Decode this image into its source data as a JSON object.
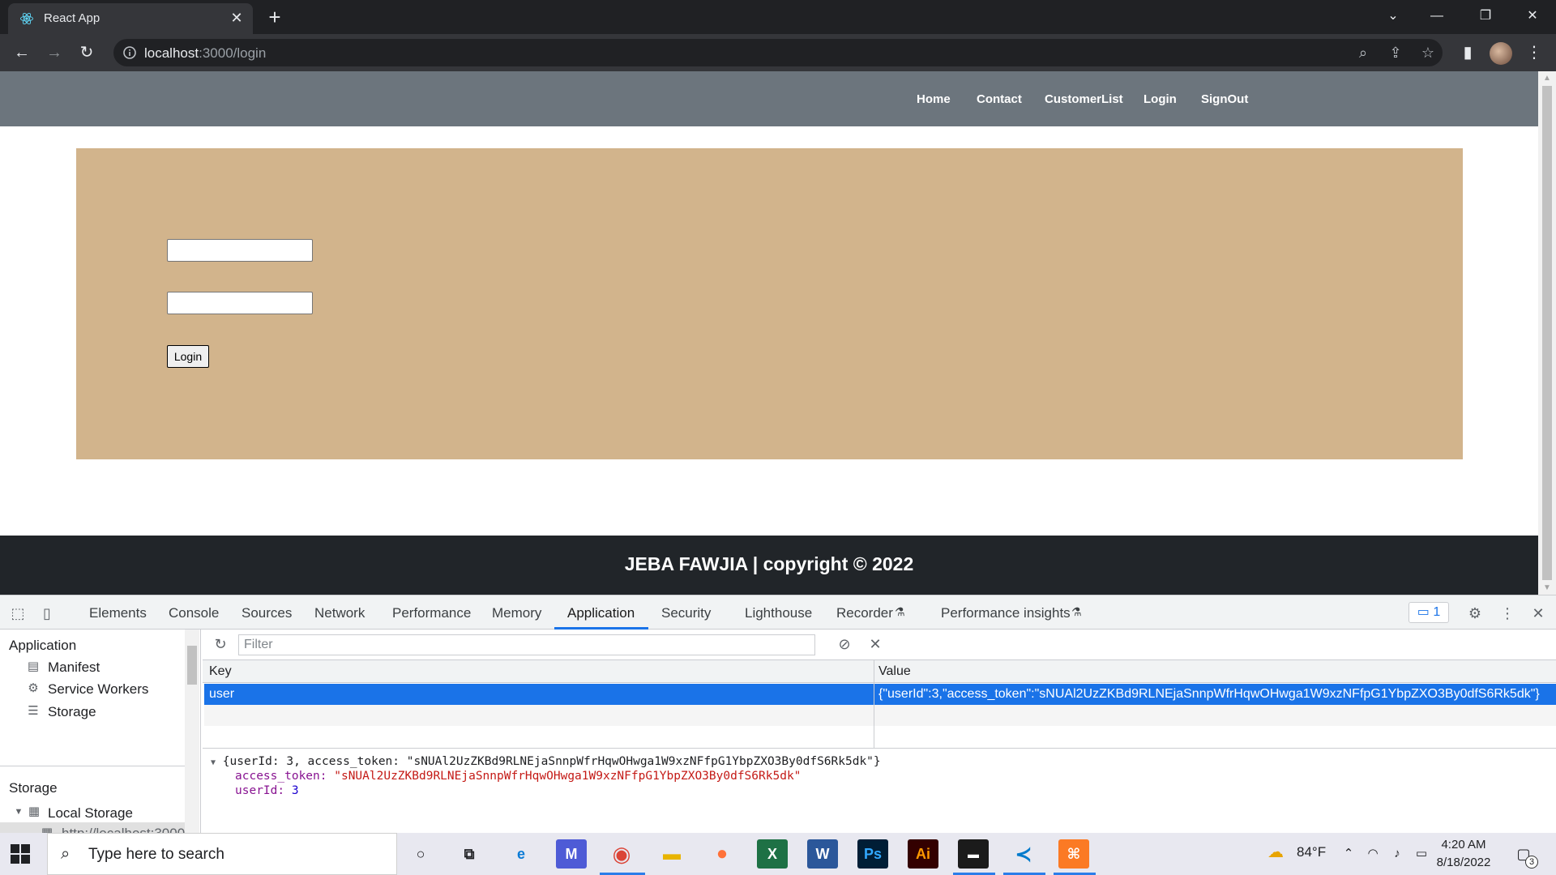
{
  "browser": {
    "tab_title": "React App",
    "tab_close": "✕",
    "new_tab": "+",
    "url_host": "localhost",
    "url_rest": ":3000/login",
    "window_controls": {
      "dropdown": "⌄",
      "minimize": "—",
      "restore": "❐",
      "close": "✕"
    }
  },
  "page": {
    "nav": [
      "Home",
      "Contact",
      "CustomerList",
      "Login",
      "SignOut"
    ],
    "login_form": {
      "username_value": "",
      "password_value": "",
      "submit_label": "Login"
    },
    "footer": "JEBA FAWJIA | copyright © 2022",
    "colors": {
      "navbar": "#6c757d",
      "card": "#d2b48c",
      "footer": "#212529"
    }
  },
  "devtools": {
    "tabs": [
      "Elements",
      "Console",
      "Sources",
      "Network",
      "Performance",
      "Memory",
      "Application",
      "Security",
      "Lighthouse",
      "Recorder",
      "Performance insights"
    ],
    "active_tab": "Application",
    "issues_count": "1",
    "sidebar": {
      "application_heading": "Application",
      "application_items": [
        "Manifest",
        "Service Workers",
        "Storage"
      ],
      "storage_heading": "Storage",
      "local_storage": "Local Storage",
      "origin": "http://localhost:3000"
    },
    "filter_placeholder": "Filter",
    "table": {
      "key_header": "Key",
      "value_header": "Value",
      "rows": [
        {
          "key": "user",
          "value": "{\"userId\":3,\"access_token\":\"sNUAl2UzZKBd9RLNEjaSnnpWfrHqwOHwga1W9xzNFfpG1YbpZXO3By0dfS6Rk5dk\"}"
        }
      ]
    },
    "preview": {
      "summary": "{userId: 3, access_token: \"sNUAl2UzZKBd9RLNEjaSnnpWfrHqwOHwga1W9xzNFfpG1YbpZXO3By0dfS6Rk5dk\"}",
      "access_token_key": "access_token:",
      "access_token_value": "\"sNUAl2UzZKBd9RLNEjaSnnpWfrHqwOHwga1W9xzNFfpG1YbpZXO3By0dfS6Rk5dk\"",
      "userId_key": "userId:",
      "userId_value": "3"
    }
  },
  "taskbar": {
    "search_placeholder": "Type here to search",
    "temperature": "84°F",
    "time": "4:20 AM",
    "date": "8/18/2022",
    "notification_count": "3"
  }
}
